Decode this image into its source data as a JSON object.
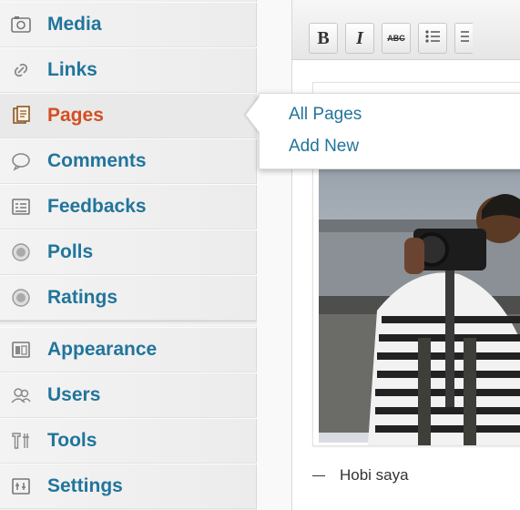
{
  "sidebar": {
    "items": [
      {
        "key": "media",
        "label": "Media",
        "icon": "media-icon"
      },
      {
        "key": "links",
        "label": "Links",
        "icon": "links-icon"
      },
      {
        "key": "pages",
        "label": "Pages",
        "icon": "pages-icon",
        "active": true
      },
      {
        "key": "comments",
        "label": "Comments",
        "icon": "comments-icon"
      },
      {
        "key": "feedbacks",
        "label": "Feedbacks",
        "icon": "feedbacks-icon"
      },
      {
        "key": "polls",
        "label": "Polls",
        "icon": "polls-icon"
      },
      {
        "key": "ratings",
        "label": "Ratings",
        "icon": "ratings-icon"
      },
      {
        "key": "appearance",
        "label": "Appearance",
        "icon": "appearance-icon"
      },
      {
        "key": "users",
        "label": "Users",
        "icon": "users-icon"
      },
      {
        "key": "tools",
        "label": "Tools",
        "icon": "tools-icon"
      },
      {
        "key": "settings",
        "label": "Settings",
        "icon": "settings-icon"
      }
    ]
  },
  "flyout": {
    "all_pages": "All Pages",
    "add_new": "Add New"
  },
  "editor": {
    "toolbar": {
      "bold": "B",
      "italic": "I",
      "strike": "ABC"
    },
    "caption": "Hobi saya"
  },
  "colors": {
    "link": "#21759b",
    "active": "#d54e21"
  }
}
